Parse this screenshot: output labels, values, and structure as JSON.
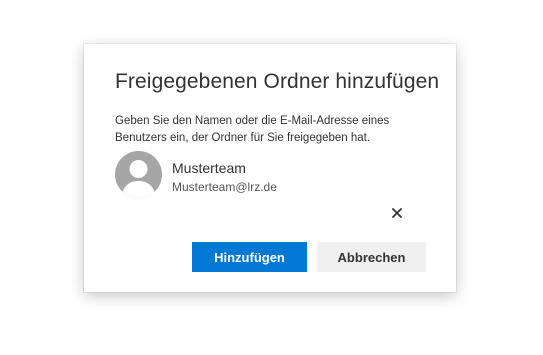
{
  "dialog": {
    "title": "Freigegebenen Ordner hinzufügen",
    "description": "Geben Sie den Namen oder die E-Mail-Adresse eines Benutzers ein, der Ordner für Sie freigegeben hat.",
    "persona": {
      "name": "Musterteam",
      "email": "Musterteam@lrz.de",
      "avatar_icon": "person-icon"
    },
    "remove_icon": "close-icon",
    "buttons": {
      "primary_label": "Hinzufügen",
      "secondary_label": "Abbrechen"
    },
    "colors": {
      "primary": "#0078d4",
      "secondary_bg": "#f0f0f0",
      "avatar_bg": "#a6a6a6"
    }
  }
}
